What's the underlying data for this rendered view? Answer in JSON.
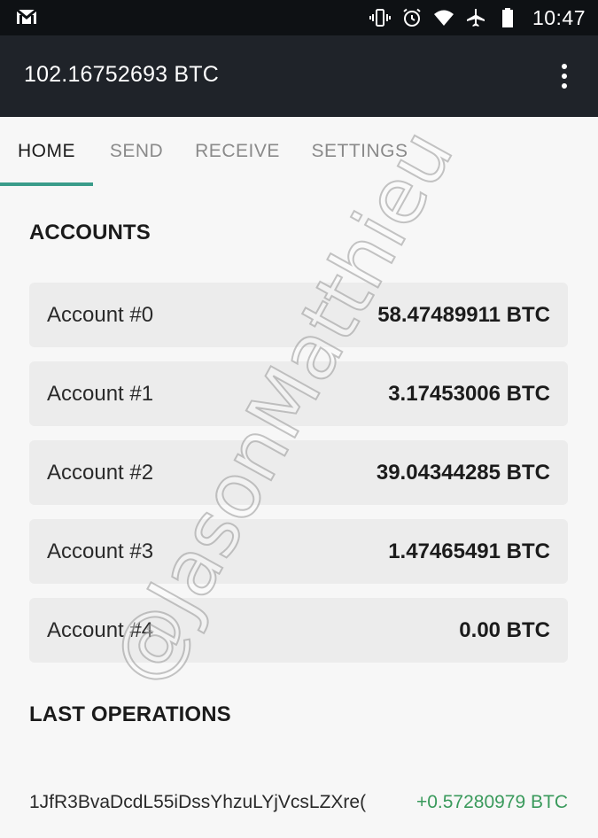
{
  "status_bar": {
    "time": "10:47",
    "icons": [
      "gmail-icon",
      "vibrate-icon",
      "alarm-icon",
      "wifi-icon",
      "airplane-icon",
      "battery-icon"
    ]
  },
  "app_bar": {
    "title": "102.16752693 BTC",
    "menu_icon": "overflow-menu-icon"
  },
  "tabs": [
    {
      "label": "HOME",
      "active": true
    },
    {
      "label": "SEND",
      "active": false
    },
    {
      "label": "RECEIVE",
      "active": false
    },
    {
      "label": "SETTINGS",
      "active": false
    }
  ],
  "accounts_section": {
    "title": "ACCOUNTS",
    "items": [
      {
        "name": "Account #0",
        "balance": "58.47489911 BTC"
      },
      {
        "name": "Account #1",
        "balance": "3.17453006 BTC"
      },
      {
        "name": "Account #2",
        "balance": "39.04344285 BTC"
      },
      {
        "name": "Account #3",
        "balance": "1.47465491 BTC"
      },
      {
        "name": "Account #4",
        "balance": "0.00 BTC"
      }
    ]
  },
  "operations_section": {
    "title": "LAST OPERATIONS",
    "items": [
      {
        "address": "1JfR3BvaDcdL55iDssYhzuLYjVcsLZXre(",
        "amount": "+0.57280979 BTC"
      }
    ]
  },
  "watermark": "@JasonMatthieu",
  "colors": {
    "accent": "#3a9c8a",
    "positive_amount": "#3a9a5c",
    "app_bar": "#1f2329",
    "status_bar": "#0e1114"
  }
}
